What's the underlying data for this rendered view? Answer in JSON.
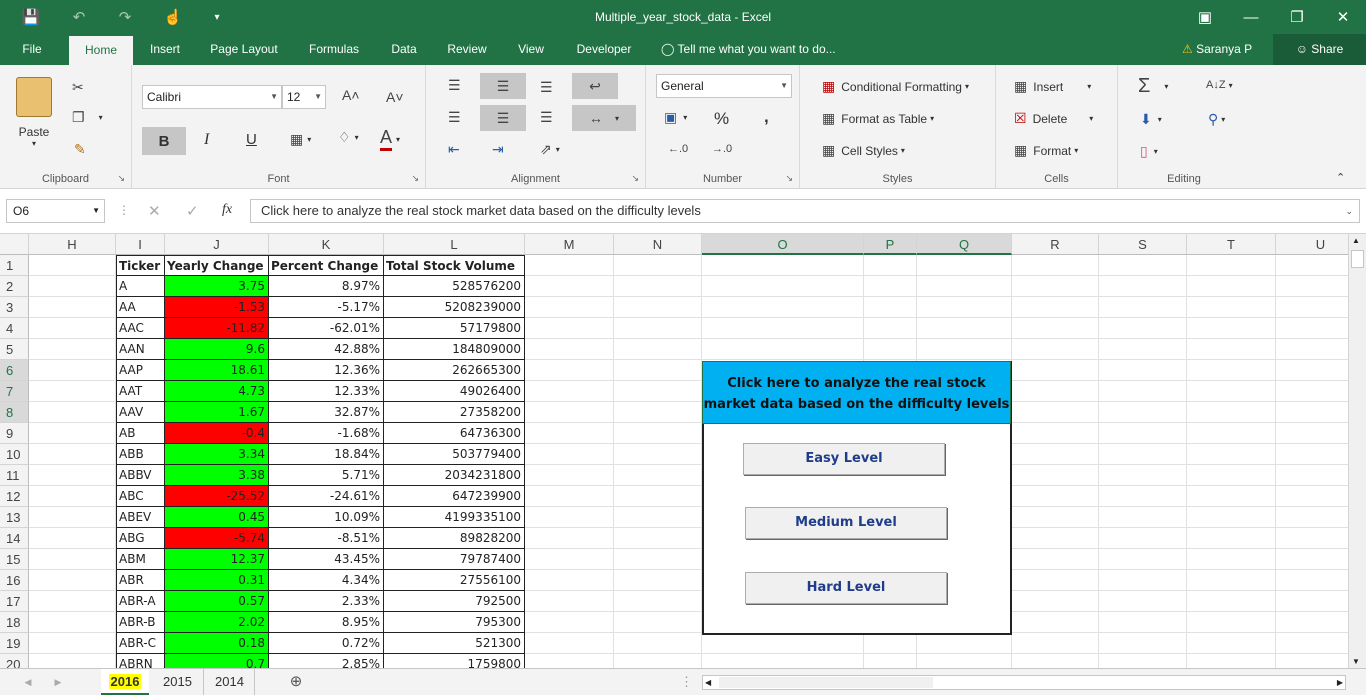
{
  "window": {
    "title": "Multiple_year_stock_data - Excel"
  },
  "ribbon_tabs": [
    "File",
    "Home",
    "Insert",
    "Page Layout",
    "Formulas",
    "Data",
    "Review",
    "View",
    "Developer"
  ],
  "active_tab": "Home",
  "tell_me": "Tell me what you want to do...",
  "user": "Saranya P",
  "share": "Share",
  "ribbon": {
    "clipboard": {
      "label": "Clipboard",
      "paste": "Paste"
    },
    "font": {
      "label": "Font",
      "name": "Calibri",
      "size": "12",
      "bold": "B",
      "italic": "I",
      "underline": "U"
    },
    "alignment": {
      "label": "Alignment"
    },
    "number": {
      "label": "Number",
      "format": "General",
      "percent": "%",
      "comma": ","
    },
    "styles": {
      "label": "Styles",
      "conditional": "Conditional Formatting",
      "table": "Format as Table",
      "cell_styles": "Cell Styles"
    },
    "cells": {
      "label": "Cells",
      "insert": "Insert",
      "delete": "Delete",
      "format": "Format"
    },
    "editing": {
      "label": "Editing"
    }
  },
  "formula_bar": {
    "name_box": "O6",
    "formula": "Click here to analyze the real stock market data based on the difficulty levels"
  },
  "columns": [
    "H",
    "I",
    "J",
    "K",
    "L",
    "M",
    "N",
    "O",
    "P",
    "Q",
    "R",
    "S",
    "T",
    "U"
  ],
  "rows": [
    "1",
    "2",
    "3",
    "4",
    "5",
    "6",
    "7",
    "8",
    "9",
    "10",
    "11",
    "12",
    "13",
    "14",
    "15",
    "16",
    "17",
    "18",
    "19",
    "20"
  ],
  "table": {
    "headers": [
      "Ticker",
      "Yearly Change",
      "Percent Change",
      "Total Stock Volume"
    ],
    "rows": [
      {
        "ticker": "A",
        "change": "3.75",
        "pct": "8.97%",
        "vol": "528576200",
        "pos": true
      },
      {
        "ticker": "AA",
        "change": "-1.53",
        "pct": "-5.17%",
        "vol": "5208239000",
        "pos": false
      },
      {
        "ticker": "AAC",
        "change": "-11.82",
        "pct": "-62.01%",
        "vol": "57179800",
        "pos": false
      },
      {
        "ticker": "AAN",
        "change": "9.6",
        "pct": "42.88%",
        "vol": "184809000",
        "pos": true
      },
      {
        "ticker": "AAP",
        "change": "18.61",
        "pct": "12.36%",
        "vol": "262665300",
        "pos": true
      },
      {
        "ticker": "AAT",
        "change": "4.73",
        "pct": "12.33%",
        "vol": "49026400",
        "pos": true
      },
      {
        "ticker": "AAV",
        "change": "1.67",
        "pct": "32.87%",
        "vol": "27358200",
        "pos": true
      },
      {
        "ticker": "AB",
        "change": "-0.4",
        "pct": "-1.68%",
        "vol": "64736300",
        "pos": false
      },
      {
        "ticker": "ABB",
        "change": "3.34",
        "pct": "18.84%",
        "vol": "503779400",
        "pos": true
      },
      {
        "ticker": "ABBV",
        "change": "3.38",
        "pct": "5.71%",
        "vol": "2034231800",
        "pos": true
      },
      {
        "ticker": "ABC",
        "change": "-25.52",
        "pct": "-24.61%",
        "vol": "647239900",
        "pos": false
      },
      {
        "ticker": "ABEV",
        "change": "0.45",
        "pct": "10.09%",
        "vol": "4199335100",
        "pos": true
      },
      {
        "ticker": "ABG",
        "change": "-5.74",
        "pct": "-8.51%",
        "vol": "89828200",
        "pos": false
      },
      {
        "ticker": "ABM",
        "change": "12.37",
        "pct": "43.45%",
        "vol": "79787400",
        "pos": true
      },
      {
        "ticker": "ABR",
        "change": "0.31",
        "pct": "4.34%",
        "vol": "27556100",
        "pos": true
      },
      {
        "ticker": "ABR-A",
        "change": "0.57",
        "pct": "2.33%",
        "vol": "792500",
        "pos": true
      },
      {
        "ticker": "ABR-B",
        "change": "2.02",
        "pct": "8.95%",
        "vol": "795300",
        "pos": true
      },
      {
        "ticker": "ABR-C",
        "change": "0.18",
        "pct": "0.72%",
        "vol": "521300",
        "pos": true
      },
      {
        "ticker": "ABRN",
        "change": "0.7",
        "pct": "2.85%",
        "vol": "1759800",
        "pos": true
      }
    ]
  },
  "colors": {
    "positive": "#00ff00",
    "negative": "#ff0000",
    "button": "#00b0f0",
    "accent": "#217346"
  },
  "panel": {
    "main_button": "Click here to analyze the real stock market data based on the difficulty levels",
    "easy": "Easy Level",
    "medium": "Medium Level",
    "hard": "Hard Level"
  },
  "sheets": [
    "2016",
    "2015",
    "2014"
  ],
  "active_sheet": "2016"
}
